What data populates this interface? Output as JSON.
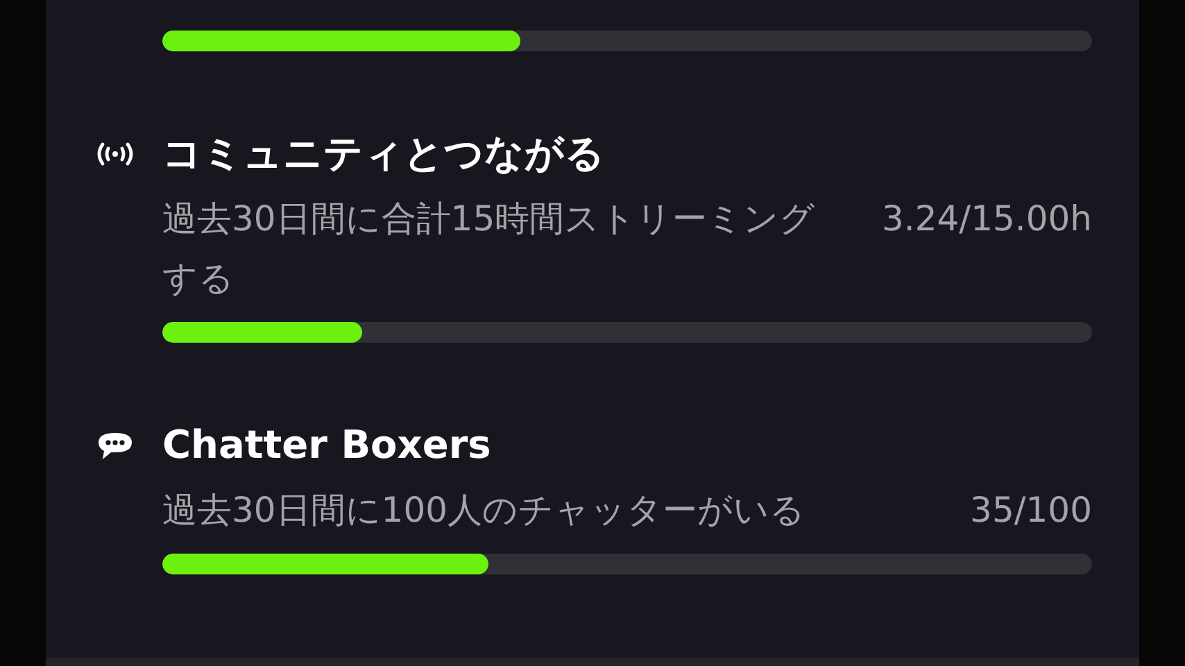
{
  "top_bar": {
    "level": 0.385
  },
  "goals": [
    {
      "kind": "broadcast",
      "title": "コミュニティとつながる",
      "description": "過去30日間に合計15時間ストリーミングする",
      "reading": "3.24/15.00h",
      "level": 0.215
    },
    {
      "kind": "chat",
      "title": "Chatter Boxers",
      "description": "過去30日間に100人のチャッターがいる",
      "reading": "35/100",
      "level": 0.35
    }
  ]
}
